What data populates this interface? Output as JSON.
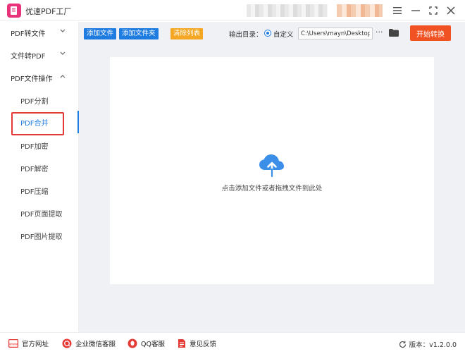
{
  "window": {
    "title": "优速PDF工厂"
  },
  "sidebar": {
    "groups": [
      {
        "label": "PDF转文件"
      },
      {
        "label": "文件转PDF"
      },
      {
        "label": "PDF文件操作"
      }
    ],
    "items": [
      {
        "label": "PDF分割"
      },
      {
        "label": "PDF合并",
        "active": true
      },
      {
        "label": "PDF加密"
      },
      {
        "label": "PDF解密"
      },
      {
        "label": "PDF压缩"
      },
      {
        "label": "PDF页面提取"
      },
      {
        "label": "PDF图片提取"
      }
    ]
  },
  "toolbar": {
    "add_file": "添加文件",
    "add_folder": "添加文件夹",
    "clear_list": "清除列表",
    "output_label": "输出目录：",
    "radio_label": "自定义",
    "output_path": "C:\\Users\\mayn\\Desktop",
    "more": "···",
    "start": "开始转换"
  },
  "dropzone": {
    "hint": "点击添加文件或者拖拽文件到此处"
  },
  "bottom": {
    "website": "官方网址",
    "wechat": "企业微信客服",
    "qq": "QQ客服",
    "feedback": "意见反馈",
    "version": "版本：v1.2.0.0"
  },
  "colors": {
    "accent": "#1e7be0",
    "start": "#f05223",
    "clear": "#f5a623",
    "logo": "#e8337a",
    "highlight": "#e53935"
  }
}
